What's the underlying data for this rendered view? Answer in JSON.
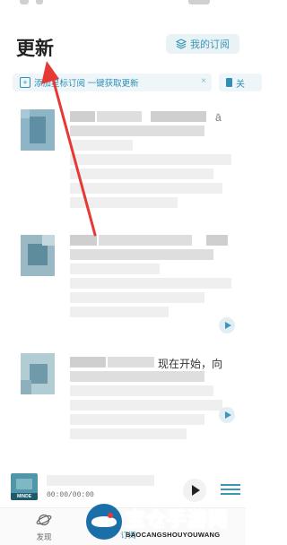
{
  "header": {
    "title": "更新",
    "subscriptions_button": "我的订阅"
  },
  "hint_bar": {
    "text": "添加星标订阅 一键获取更新",
    "close": "×"
  },
  "hint_bar_2": {
    "text": "关"
  },
  "feed": [
    {
      "visible_text": ""
    },
    {
      "visible_text": ""
    },
    {
      "visible_text": "现在开始，向"
    }
  ],
  "player": {
    "art_caption": "MINDE",
    "time": "00:00/00:00"
  },
  "tabs": [
    {
      "label": "发现"
    },
    {
      "label": "订阅"
    },
    {
      "label": ""
    },
    {
      "label": ""
    }
  ],
  "watermark": {
    "title": "宝仓手游网",
    "subtitle": "BAOCANGSHOUYOUWANG"
  },
  "colors": {
    "accent": "#3a95b5",
    "annotation_arrow": "#e53935",
    "watermark_red": "#d6212b"
  },
  "icons": {
    "subscriptions": "layers-icon",
    "hint_add": "plus-square-icon",
    "hint_close": "close-icon",
    "feed_play": "play-icon",
    "player_play": "play-icon",
    "player_list": "playlist-icon",
    "tab_discover": "planet-icon"
  }
}
